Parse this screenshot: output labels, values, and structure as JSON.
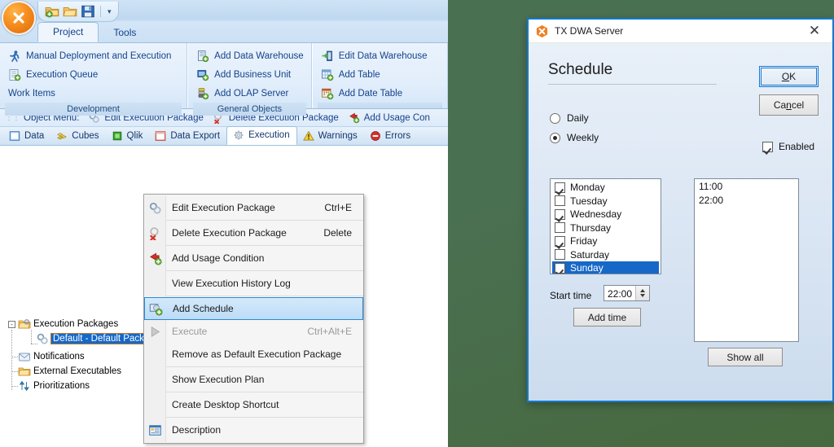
{
  "app": {
    "orb_icon": "close-x-orb-icon",
    "quick_access": [
      {
        "name": "new-project-icon",
        "label": "New Project"
      },
      {
        "name": "open-project-icon",
        "label": "Open Project"
      },
      {
        "name": "save-icon",
        "label": "Save"
      }
    ],
    "qat_dropdown": "▾",
    "tabs": [
      {
        "label": "Project",
        "active": true
      },
      {
        "label": "Tools",
        "active": false
      }
    ],
    "ribbon_groups": [
      {
        "label": "Development",
        "items": [
          {
            "label": "Manual Deployment and Execution",
            "icon": "person-run-icon"
          },
          {
            "label": "Execution Queue",
            "icon": "queue-icon"
          },
          {
            "label": "Work Items",
            "icon": "none"
          }
        ]
      },
      {
        "label": "General Objects",
        "items": [
          {
            "label": "Add Data Warehouse",
            "icon": "add-data-warehouse-icon"
          },
          {
            "label": "Add Business Unit",
            "icon": "add-business-unit-icon"
          },
          {
            "label": "Add OLAP Server",
            "icon": "add-olap-server-icon"
          }
        ]
      },
      {
        "label": "",
        "items": [
          {
            "label": "Edit Data Warehouse",
            "icon": "edit-data-warehouse-icon"
          },
          {
            "label": "Add Table",
            "icon": "add-table-icon"
          },
          {
            "label": "Add Date Table",
            "icon": "add-date-table-icon"
          }
        ]
      }
    ],
    "object_menu": {
      "prefix": "Object Menu:",
      "items": [
        {
          "label": "Edit Execution Package",
          "icon": "edit-package-icon"
        },
        {
          "label": "Delete Execution Package",
          "icon": "delete-package-icon"
        },
        {
          "label": "Add Usage Con",
          "icon": "add-usage-condition-icon"
        }
      ]
    },
    "doc_tabs": [
      {
        "label": "Data",
        "icon": "data-icon",
        "active": false
      },
      {
        "label": "Cubes",
        "icon": "cubes-icon",
        "active": false
      },
      {
        "label": "Qlik",
        "icon": "qlik-icon",
        "active": false
      },
      {
        "label": "Data Export",
        "icon": "data-export-icon",
        "active": false
      },
      {
        "label": "Execution",
        "icon": "execution-gear-icon",
        "active": true
      },
      {
        "label": "Warnings",
        "icon": "warning-triangle-icon",
        "active": false
      },
      {
        "label": "Errors",
        "icon": "error-circle-icon",
        "active": false
      }
    ],
    "tree": [
      {
        "label": "Execution Packages",
        "icon": "package-folder-icon",
        "level": 0,
        "expander": "-",
        "selected": false
      },
      {
        "label": "Default - Default Package",
        "icon": "package-icon",
        "level": 1,
        "expander": "",
        "selected": true
      },
      {
        "label": "Notifications",
        "icon": "notification-envelope-icon",
        "level": 0,
        "expander": "",
        "selected": false
      },
      {
        "label": "External Executables",
        "icon": "external-folder-icon",
        "level": 0,
        "expander": "",
        "selected": false
      },
      {
        "label": "Prioritizations",
        "icon": "prioritization-arrows-icon",
        "level": 0,
        "expander": "",
        "selected": false
      }
    ]
  },
  "context_menu": {
    "items": [
      {
        "label": "Edit Execution Package",
        "shortcut": "Ctrl+E",
        "icon": "edit-package-icon",
        "disabled": false,
        "selected": false,
        "sep_after": true
      },
      {
        "label": "Delete Execution Package",
        "shortcut": "Delete",
        "icon": "delete-package-icon",
        "disabled": false,
        "selected": false,
        "sep_after": true
      },
      {
        "label": "Add Usage Condition",
        "shortcut": "",
        "icon": "add-usage-condition-icon",
        "disabled": false,
        "selected": false,
        "sep_after": true
      },
      {
        "label": "View Execution History Log",
        "shortcut": "",
        "icon": "none",
        "disabled": false,
        "selected": false,
        "sep_after": true
      },
      {
        "label": "Add Schedule",
        "shortcut": "",
        "icon": "add-schedule-icon",
        "disabled": false,
        "selected": true,
        "sep_after": false
      },
      {
        "label": "Execute",
        "shortcut": "Ctrl+Alt+E",
        "icon": "play-icon",
        "disabled": true,
        "selected": false,
        "sep_after": false
      },
      {
        "label": "Remove as Default Execution Package",
        "shortcut": "",
        "icon": "none",
        "disabled": false,
        "selected": false,
        "sep_after": true
      },
      {
        "label": "Show Execution Plan",
        "shortcut": "",
        "icon": "none",
        "disabled": false,
        "selected": false,
        "sep_after": true
      },
      {
        "label": "Create Desktop Shortcut",
        "shortcut": "",
        "icon": "none",
        "disabled": false,
        "selected": false,
        "sep_after": true
      },
      {
        "label": "Description",
        "shortcut": "",
        "icon": "description-icon",
        "disabled": false,
        "selected": false,
        "sep_after": false
      }
    ]
  },
  "dialog": {
    "title": "TX DWA Server",
    "title_icon": "tx-dwa-orange-icon",
    "close_label": "✕",
    "heading": "Schedule",
    "ok_label": "OK",
    "ok_accel": "O",
    "cancel_label": "Cancel",
    "cancel_accel": "n",
    "enabled_label": "Enabled",
    "enabled_checked": true,
    "frequency": [
      {
        "label": "Daily",
        "selected": false
      },
      {
        "label": "Weekly",
        "selected": true
      }
    ],
    "days": [
      {
        "label": "Monday",
        "checked": true,
        "highlighted": false
      },
      {
        "label": "Tuesday",
        "checked": false,
        "highlighted": false
      },
      {
        "label": "Wednesday",
        "checked": true,
        "highlighted": false
      },
      {
        "label": "Thursday",
        "checked": false,
        "highlighted": false
      },
      {
        "label": "Friday",
        "checked": true,
        "highlighted": false
      },
      {
        "label": "Saturday",
        "checked": false,
        "highlighted": false
      },
      {
        "label": "Sunday",
        "checked": true,
        "highlighted": true
      }
    ],
    "start_time_label": "Start time",
    "start_time_value": "22:00",
    "add_time_label": "Add time",
    "times": [
      "11:00",
      "22:00"
    ],
    "show_all_label": "Show all"
  },
  "colors": {
    "desktop_green": "#4a7052",
    "ribbon_blue": "#15428b",
    "selection_blue": "#1668c8",
    "dialog_border": "#1479d0",
    "orange_accent": "#f78d1e"
  }
}
